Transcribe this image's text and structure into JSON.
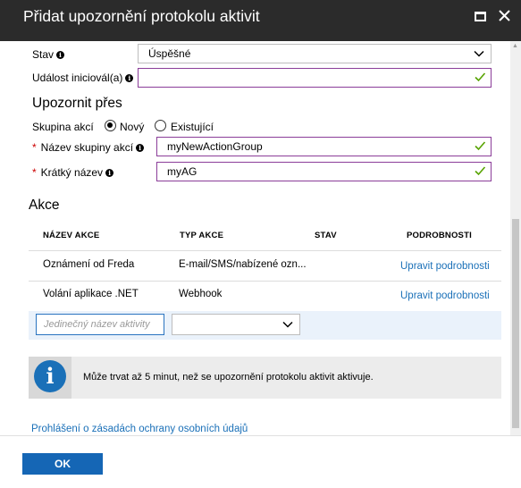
{
  "window": {
    "title": "Přidat upozornění protokolu aktivit"
  },
  "form": {
    "status_label": "Stav",
    "status_value": "Úspěšné",
    "initiator_label": "Událost iniciovál(a)",
    "initiator_value": ""
  },
  "notify": {
    "heading": "Upozornit přes",
    "group_label": "Skupina akcí",
    "option_new": "Nový",
    "option_existing": "Existující",
    "selected_option": "Nový",
    "group_name_label": "Název skupiny akcí",
    "group_name_value": "myNewActionGroup",
    "short_name_label": "Krátký název",
    "short_name_value": "myAG"
  },
  "actions": {
    "heading": "Akce",
    "columns": [
      "NÁZEV AKCE",
      "TYP AKCE",
      "STAV",
      "PODROBNOSTI"
    ],
    "rows": [
      {
        "name": "Oznámení od Freda",
        "type": "E-mail/SMS/nabízené ozn...",
        "status": "",
        "details": "Upravit podrobnosti"
      },
      {
        "name": "Volání aplikace .NET",
        "type": "Webhook",
        "status": "",
        "details": "Upravit podrobnosti"
      }
    ],
    "new_name_placeholder": "Jedinečný název aktivity",
    "new_type_value": ""
  },
  "info": {
    "text": "Může trvat až 5 minut, než se upozornění protokolu aktivit aktivuje."
  },
  "privacy_link": "Prohlášení o zásadách ochrany osobních údajů",
  "footer": {
    "ok_label": "OK"
  },
  "colors": {
    "titlebar": "#2b2b2b",
    "accent": "#1566b5",
    "link": "#1a70b8",
    "valid_border": "#8b3d99",
    "check": "#57a300",
    "required": "#c00000"
  }
}
